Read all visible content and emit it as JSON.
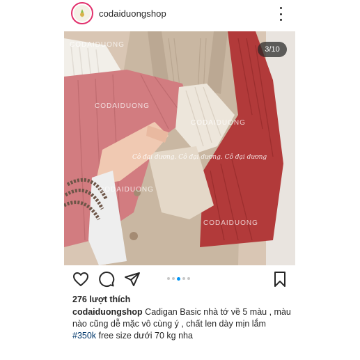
{
  "header": {
    "username": "codaiduongshop",
    "avatar_icon": "brand-logo-icon",
    "more_icon": "more-vertical-icon"
  },
  "media": {
    "counter": "3/10",
    "watermarks": [
      "CODAIDUONG",
      "CODAIDUONG",
      "CODAIDUONG",
      "CODAIDUONG",
      "CODAIDUONG"
    ],
    "watermark_script": "Cô đại dương. Cô đại dương. Cô đại dương"
  },
  "actions": {
    "like_icon": "heart-icon",
    "comment_icon": "comment-icon",
    "share_icon": "send-icon",
    "save_icon": "bookmark-icon",
    "carousel_dots": 5,
    "carousel_active_index": 2
  },
  "post": {
    "likes": "276 lượt thích",
    "caption_user": "codaiduongshop",
    "caption_text": " Cadigan Basic nhà tớ về 5 màu , màu nào cũng dễ mặc vô cùng ý , chất len dày mịn lắm",
    "hashtag": "#350k",
    "caption_tail": " free size dưới 70 kg nha"
  },
  "colors": {
    "accent_blue": "#0095f6",
    "hashtag": "#00376b",
    "text": "#262626"
  }
}
